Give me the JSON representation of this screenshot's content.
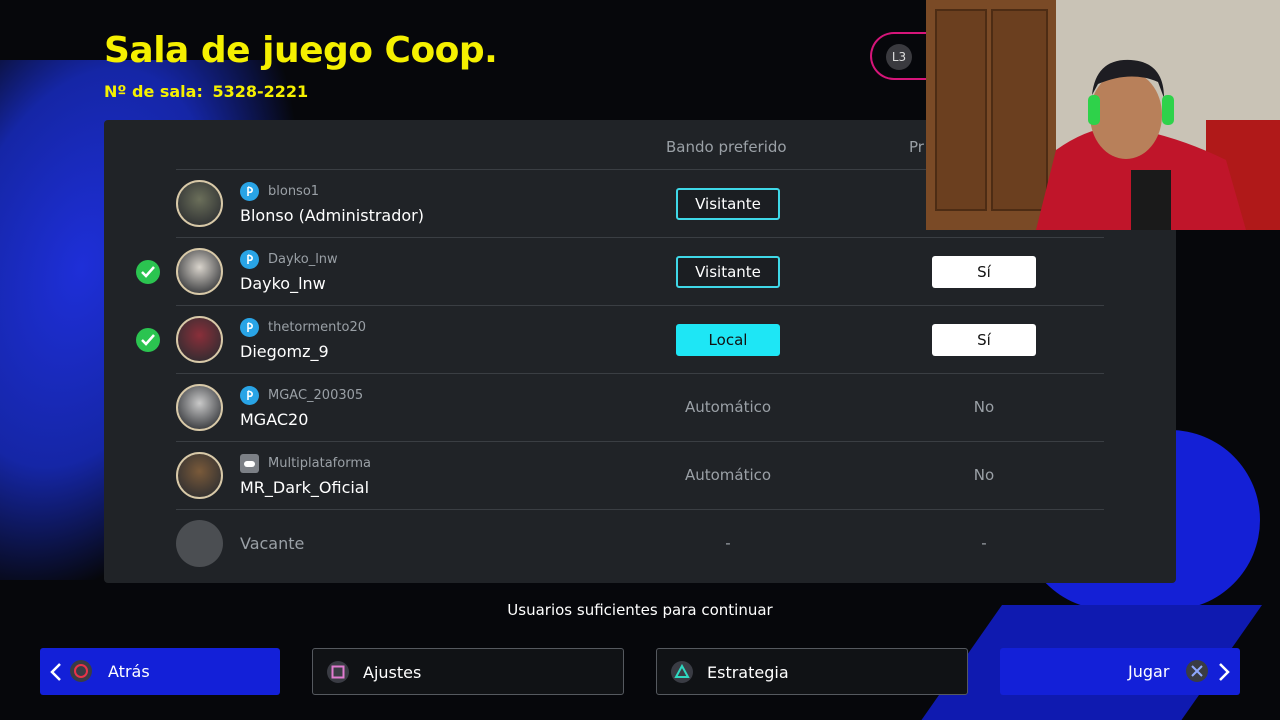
{
  "header": {
    "title": "Sala de juego Coop.",
    "room_label": "Nº de sala:",
    "room_number": "5328-2221",
    "l3_label": "L3"
  },
  "table": {
    "col_side": "Bando preferido",
    "col_pref": "Pr"
  },
  "players": [
    {
      "platform": "playstation",
      "user_id": "blonso1",
      "name": "Blonso (Administrador)",
      "ready": false,
      "side": "Visitante",
      "side_style": "outline",
      "pref": ""
    },
    {
      "platform": "playstation",
      "user_id": "Dayko_lnw",
      "name": "Dayko_lnw",
      "ready": true,
      "side": "Visitante",
      "side_style": "outline",
      "pref": "Sí"
    },
    {
      "platform": "playstation",
      "user_id": "thetormento20",
      "name": "Diegomz_9",
      "ready": true,
      "side": "Local",
      "side_style": "filled",
      "pref": "Sí"
    },
    {
      "platform": "playstation",
      "user_id": "MGAC_200305",
      "name": "MGAC20",
      "ready": false,
      "side": "Automático",
      "side_style": "text",
      "pref": "No"
    },
    {
      "platform": "multi",
      "user_id": "Multiplataforma",
      "name": "MR_Dark_Oficial",
      "ready": false,
      "side": "Automático",
      "side_style": "text",
      "pref": "No"
    },
    {
      "platform": "none",
      "user_id": "",
      "name": "Vacante",
      "ready": false,
      "side": "-",
      "side_style": "text",
      "pref": "-"
    }
  ],
  "status_message": "Usuarios suficientes para continuar",
  "buttons": {
    "back": "Atrás",
    "settings": "Ajustes",
    "strategy": "Estrategia",
    "play": "Jugar"
  },
  "colors": {
    "title_yellow": "#f5f000",
    "accent_blue": "#1320d8",
    "side_cyan": "#1ee6f5",
    "ready_green": "#2bc450"
  }
}
